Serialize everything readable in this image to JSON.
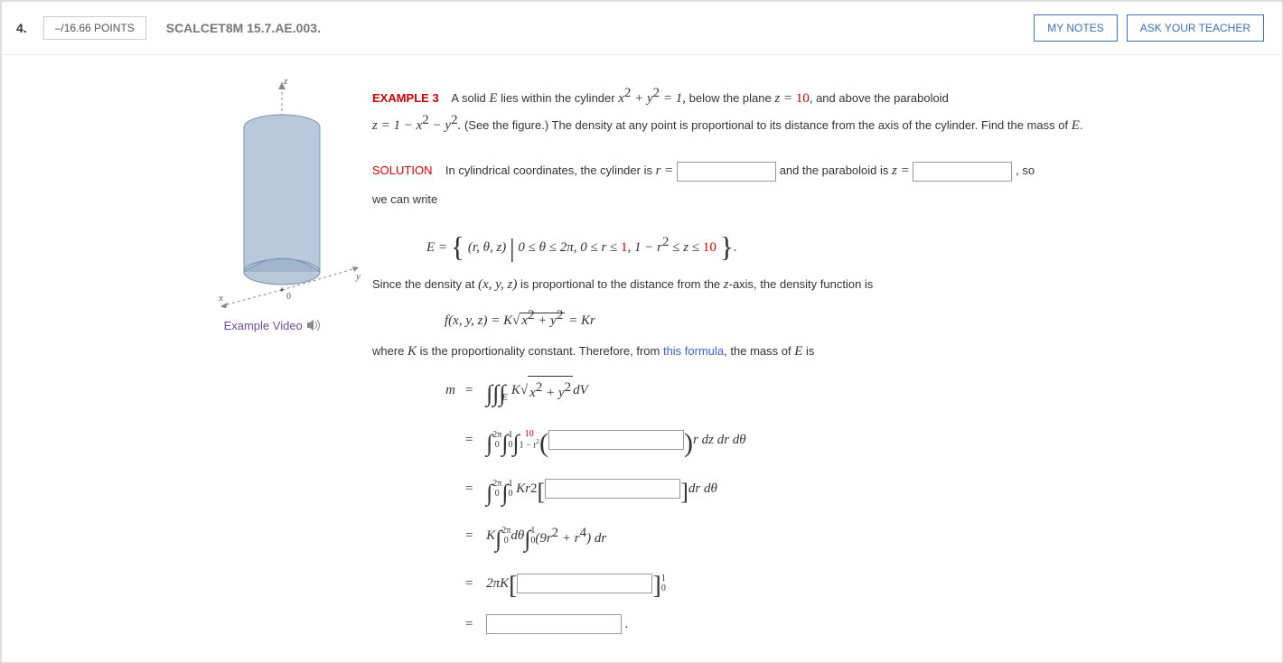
{
  "header": {
    "question_number": "4.",
    "points": "–/16.66 POINTS",
    "book_ref": "SCALCET8M 15.7.AE.003.",
    "my_notes": "MY NOTES",
    "ask_teacher": "ASK YOUR TEACHER"
  },
  "figure": {
    "video_link": "Example Video",
    "axis_x": "x",
    "axis_y": "y",
    "axis_z": "z",
    "origin": "0"
  },
  "example": {
    "label": "EXAMPLE 3",
    "text_pre": "A solid ",
    "E": "E",
    "text_a": " lies within the cylinder  ",
    "eq_cyl": "x² + y² = 1,",
    "text_b": "  below the plane  ",
    "eq_plane_lhs": "z = ",
    "eq_plane_rhs": "10",
    "eq_plane_after": ",",
    "text_c": "  and above the paraboloid",
    "eq_parab": "z = 1 − x² − y².",
    "text_d": "  (See the figure.) The density at any point is proportional to its distance from the axis of the cylinder. Find the mass of ",
    "text_e": "."
  },
  "solution": {
    "label": "SOLUTION",
    "line1_a": "In cylindrical coordinates, the cylinder is  ",
    "line1_r": "r = ",
    "line1_b": "  and the paraboloid is  ",
    "line1_z": "z = ",
    "line1_c": ",   so",
    "line2": "we can write",
    "setE_lhs": "E = ",
    "setE_body_a": "(r, θ, z)",
    "setE_body_b": " 0 ≤ θ ≤ 2π, 0 ≤ r ≤ ",
    "setE_body_b1": "1",
    "setE_body_b2": ", 1 − r",
    "setE_body_b3": " ≤ z ≤ ",
    "setE_body_b4": "10",
    "setE_end": ".",
    "line3_a": "Since the density at  ",
    "line3_xyz": "(x, y, z)",
    "line3_b": "  is proportional to the distance from the ",
    "line3_zaxis": "z",
    "line3_c": "-axis, the density function is",
    "density_eq": "f(x, y, z) = K",
    "density_sqrt": "x² + y²",
    "density_end": " = Kr",
    "line4_a": "where ",
    "line4_K": "K",
    "line4_b": " is the proportionality constant. Therefore, from ",
    "line4_link": "this formula",
    "line4_c": ", the mass of ",
    "line4_d": " is"
  },
  "mass": {
    "m": "m",
    "eq": "=",
    "triple_int": "∭",
    "int_E": "E",
    "int_body": " K",
    "int_sqrt": "x² + y²",
    "int_dv": " dV",
    "step2_post": "r dz dr dθ",
    "step3_pre": "Kr",
    "step3_post": " dr dθ",
    "step4_K": "K",
    "step4_d0": "dθ",
    "step4_body": "(9r² + r⁴) dr",
    "step5_pre": "2πK",
    "step5_lim_top": "1",
    "step5_lim_bot": "0",
    "limits": {
      "th_lo": "0",
      "th_hi": "2π",
      "r_lo": "0",
      "r_hi": "1",
      "z_lo_a": "1 − r",
      "z_lo_exp": "2",
      "z_hi": "10"
    },
    "dot": "."
  }
}
